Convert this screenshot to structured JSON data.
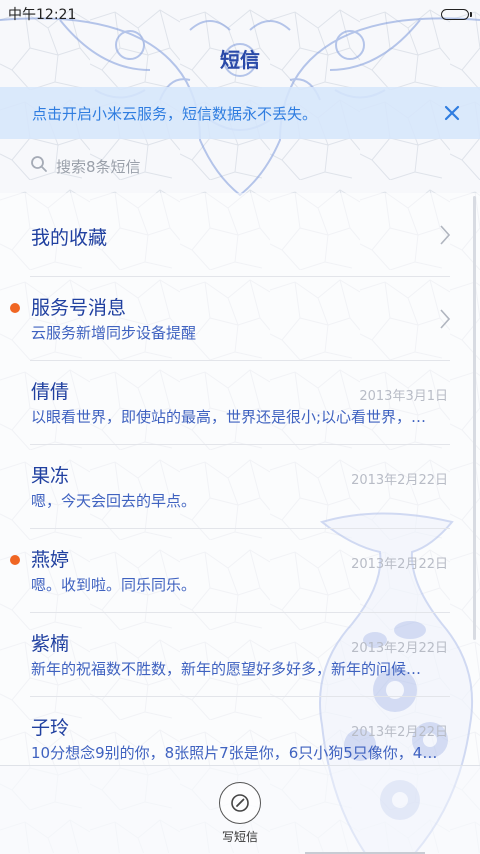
{
  "status_bar": {
    "time": "中午12:21",
    "battery_level": 1.0
  },
  "header": {
    "title": "短信"
  },
  "banner": {
    "text": "点击开启小米云服务，短信数据永不丢失。"
  },
  "search": {
    "placeholder": "搜索8条短信"
  },
  "conversations": [
    {
      "name": "我的收藏",
      "preview": "",
      "date": "",
      "unread": false,
      "chevron": true
    },
    {
      "name": "服务号消息",
      "preview": "云服务新增同步设备提醒",
      "date": "",
      "unread": true,
      "chevron": true
    },
    {
      "name": "倩倩",
      "preview": "以眼看世界，即使站的最高，世界还是很小;以心看世界，…",
      "date": "2013年3月1日",
      "unread": false,
      "chevron": false
    },
    {
      "name": "果冻",
      "preview": "嗯，今天会回去的早点。",
      "date": "2013年2月22日",
      "unread": false,
      "chevron": false
    },
    {
      "name": "燕婷",
      "preview": "嗯。收到啦。同乐同乐。",
      "date": "2013年2月22日",
      "unread": true,
      "chevron": false
    },
    {
      "name": "紫楠",
      "preview": "新年的祝福数不胜数，新年的愿望好多好多，新年的问候…",
      "date": "2013年2月22日",
      "unread": false,
      "chevron": false
    },
    {
      "name": "子玲",
      "preview": "10分想念9别的你，8张照片7张是你，6只小狗5只像你，4…",
      "date": "2013年2月22日",
      "unread": false,
      "chevron": false
    }
  ],
  "bottom": {
    "compose_label": "写短信"
  },
  "colors": {
    "accent": "#2f7de0",
    "title": "#2040a0",
    "unread_dot": "#f06623",
    "porcelain": "#3a5fc0"
  }
}
